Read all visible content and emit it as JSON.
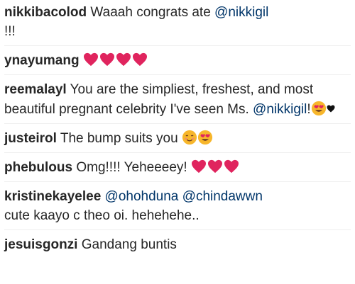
{
  "comments": [
    {
      "username": "nikkibacolod",
      "text_before": "Waaah congrats ate ",
      "mention": "@nikkigil",
      "text_after": "!!!"
    },
    {
      "username": "ynayumang",
      "emoji": [
        "red-heart",
        "red-heart",
        "red-heart",
        "red-heart"
      ]
    },
    {
      "username": "reemalayl",
      "text_before": "You are the simpliest, freshest, and most beautiful pregnant celebrity I've seen Ms. ",
      "mention": "@nikkigil",
      "text_after": "!",
      "emoji": [
        "heart-eyes-face",
        "black-heart"
      ]
    },
    {
      "username": "justeirol",
      "text": "The bump suits you",
      "emoji": [
        "smiling-face",
        "heart-eyes-face"
      ]
    },
    {
      "username": "phebulous",
      "text": "Omg!!!! Yeheeeey!",
      "emoji": [
        "red-heart",
        "red-heart",
        "red-heart"
      ]
    },
    {
      "username": "kristinekayelee",
      "mention1": "@ohohduna",
      "mention2": "@chindawwn",
      "text": "cute kaayo c theo oi. hehehehe.."
    },
    {
      "username": "jesuisgonzi",
      "text": "Gandang buntis"
    }
  ],
  "colors": {
    "username": "#262626",
    "text": "#262626",
    "mention": "#003569",
    "heart": "#e0245e",
    "face": "#f7b62b"
  }
}
